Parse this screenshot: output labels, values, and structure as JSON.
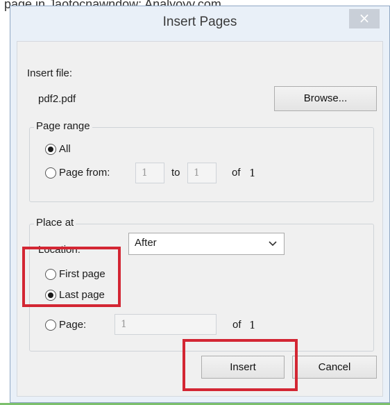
{
  "background_text": "page in Jaotocnawndow: Analyoyy.com",
  "dialog": {
    "title": "Insert Pages",
    "close_glyph": "×",
    "insert_file_label": "Insert file:",
    "file_name": "pdf2.pdf",
    "browse_label": "Browse...",
    "page_range": {
      "legend": "Page range",
      "all_label": "All",
      "all_selected": true,
      "page_from_label": "Page from:",
      "from_value": "1",
      "to_label": "to",
      "to_value": "1",
      "of_label": "of",
      "of_total": "1"
    },
    "place_at": {
      "legend": "Place at",
      "location_label": "Location:",
      "location_value": "After",
      "first_page_label": "First page",
      "last_page_label": "Last page",
      "selected": "last",
      "page_label": "Page:",
      "page_value": "1",
      "of_label": "of",
      "of_total": "1"
    },
    "insert_label": "Insert",
    "cancel_label": "Cancel"
  },
  "colors": {
    "highlight": "#d32633",
    "dialog_bg": "#e9f0f8",
    "client_bg": "#f0f0f0"
  },
  "icons": {
    "close": "close-icon",
    "dropdown": "chevron-down-icon"
  }
}
